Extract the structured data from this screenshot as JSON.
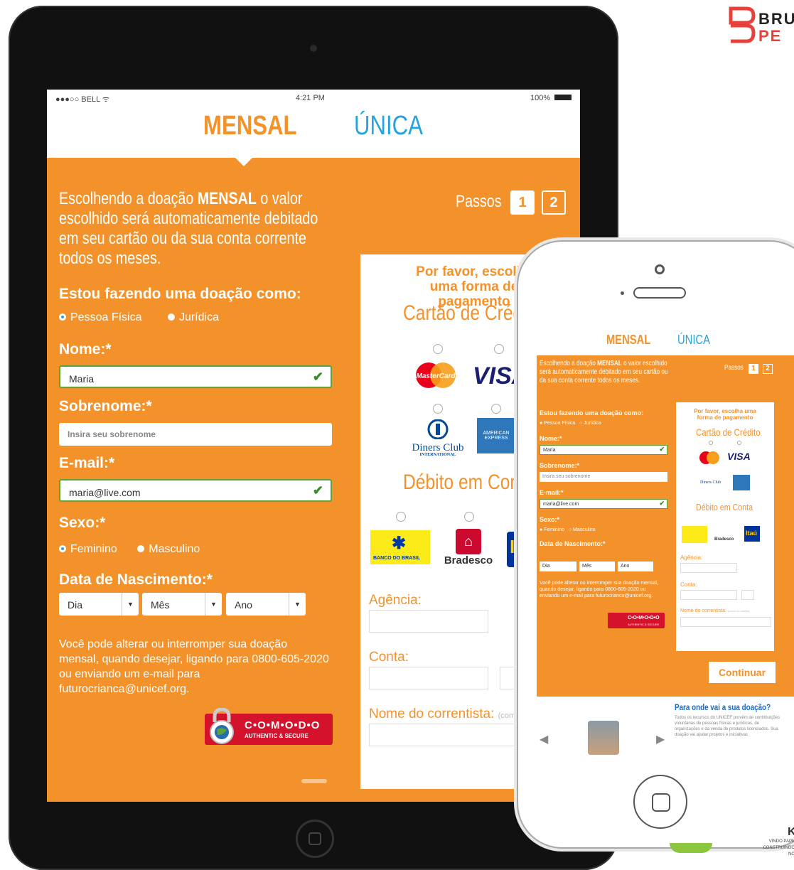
{
  "brand": {
    "line1": "BRU",
    "line2": "PE",
    "tagline_1": "VINDO PAPE",
    "tagline_2": "CONSTRUINDO NO",
    "partial": "K"
  },
  "colors": {
    "accent": "#f3922b",
    "blue": "#27a3dc",
    "green": "#5aa33a",
    "comodo": "#d5122b"
  },
  "tablet": {
    "status": {
      "carrier": "●●●○○ BELL ᯤ",
      "time": "4:21 PM",
      "battery": "100%"
    },
    "tabs": {
      "mensal": "MENSAL",
      "unica": "ÚNICA"
    },
    "intro_pre": "Escolhendo a doação ",
    "intro_bold": "MENSAL",
    "intro_post": " o valor escolhido será automaticamente debitado em seu cartão ou da sua conta corrente todos os meses.",
    "steps_label": "Passos",
    "step1": "1",
    "step2": "2",
    "donating_as_label": "Estou fazendo uma doação como:",
    "person_options": [
      "Pessoa Física",
      "Jurídica"
    ],
    "name_label": "Nome:*",
    "name_value": "Maria",
    "surname_label": "Sobrenome:*",
    "surname_placeholder": "Insira seu sobrenome",
    "email_label": "E-mail:*",
    "email_value": "maria@live.com",
    "sex_label": "Sexo:*",
    "sex_options": [
      "Feminino",
      "Masculino"
    ],
    "birth_label": "Data de Nascimento:*",
    "birth_selects": [
      "Dia",
      "Mês",
      "Ano"
    ],
    "note": "Você pode alterar ou interromper sua doação mensal, quando desejar, ligando para 0800-605-2020 ou enviando um e-mail  para futurocrianca@unicef.org.",
    "comodo_1": "C•O•M•O•D•O",
    "comodo_2": "AUTHENTIC & SECURE",
    "check": "✔",
    "payment": {
      "heading": "Por favor, escolha uma forma de pagamento",
      "credit_title": "Cartão de Crédito",
      "mastercard": "MasterCard",
      "visa": "VISA",
      "diners_1": "Diners Club",
      "diners_2": "INTERNATIONAL",
      "amex": "AMERICAN EXPRESS",
      "debit_title": "Débito em Conta",
      "bb": "BANCO DO BRASIL",
      "bradesco": "Bradesco",
      "itau": "Itaú",
      "agency_label": "Agência:",
      "account_label": "Conta:",
      "holder_label": "Nome do correntista:",
      "holder_hint": "(como no cartão)"
    }
  },
  "phone": {
    "continue": "Continuar",
    "where_title": "Para onde vai a sua doação?",
    "where_text": "Todos os recursos do UNICEF provêm de contribuições voluntárias de pessoas físicas e jurídicas, de organizações e da venda de produtos licenciados. Sua doação vai ajudar projetos e iniciativas"
  }
}
